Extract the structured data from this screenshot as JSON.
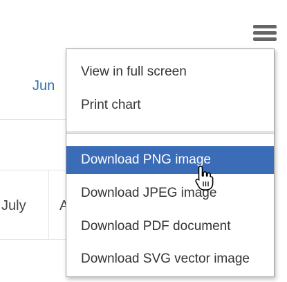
{
  "background": {
    "month_label": "Jun",
    "cell_label": "July",
    "cell_label_2": "A"
  },
  "menu": {
    "items": [
      {
        "label": "View in full screen"
      },
      {
        "label": "Print chart"
      },
      {
        "label": "Download PNG image",
        "highlighted": true
      },
      {
        "label": "Download JPEG image"
      },
      {
        "label": "Download PDF document"
      },
      {
        "label": "Download SVG vector image"
      }
    ]
  },
  "icons": {
    "context_menu": "hamburger-menu-icon",
    "pointer": "hand-pointer-icon"
  },
  "colors": {
    "highlight": "#3b6cb7",
    "month_label": "#2f6fb0",
    "hamburger": "#666666"
  }
}
